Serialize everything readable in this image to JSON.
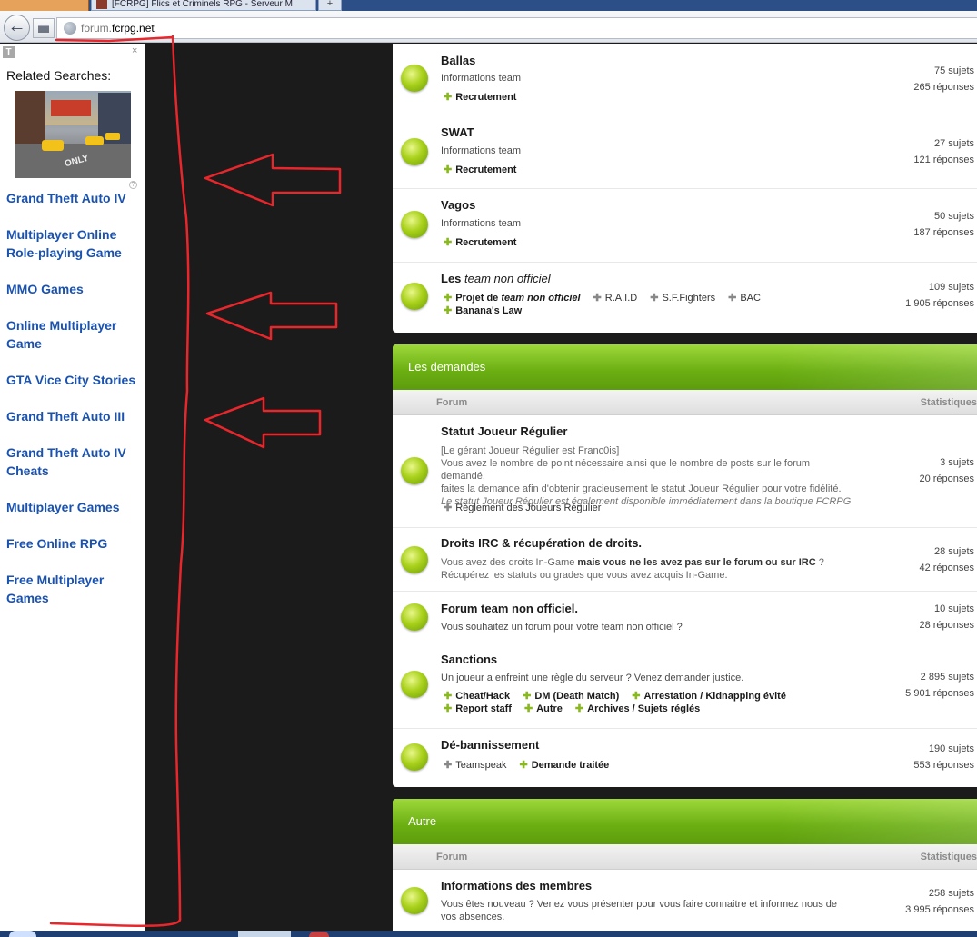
{
  "browser": {
    "tab_title": "[FCRPG] Flics et Criminels RPG - Serveur M",
    "new_tab": "+",
    "back_glyph": "←",
    "url_prefix": "forum.",
    "url_host": "fcrpg.net"
  },
  "sidepanel": {
    "badge": "T",
    "close": "×",
    "help": "?",
    "title": "Related Searches:",
    "image_caption": "ONLY",
    "links": [
      "Grand Theft Auto IV",
      "Multiplayer Online Role-playing Game",
      "MMO Games",
      "Online Multiplayer Game",
      "GTA Vice City Stories",
      "Grand Theft Auto III",
      "Grand Theft Auto IV Cheats",
      "Multiplayer Games",
      "Free Online RPG",
      "Free Multiplayer Games"
    ]
  },
  "forum": {
    "top_rows": [
      {
        "title": "Ballas",
        "desc": "Informations team",
        "sub": "Recrutement",
        "topics": "75 sujets",
        "replies": "265 réponses"
      },
      {
        "title": "SWAT",
        "desc": "Informations team",
        "sub": "Recrutement",
        "topics": "27 sujets",
        "replies": "121 réponses"
      },
      {
        "title": "Vagos",
        "desc": "Informations team",
        "sub": "Recrutement",
        "topics": "50 sujets",
        "replies": "187 réponses"
      }
    ],
    "team_row": {
      "title_a": "Les ",
      "title_b": "team non officiel",
      "sub_a1": "Projet de ",
      "sub_a2": "team non officiel",
      "sub_b": "R.A.I.D",
      "sub_c": "S.F.Fighters",
      "sub_d": "BAC",
      "sub_e": "Banana's Law",
      "topics": "109 sujets",
      "replies": "1 905 réponses"
    },
    "cat_demandes": {
      "title": "Les demandes",
      "col_forum": "Forum",
      "col_stats": "Statistiques",
      "statut": {
        "title": "Statut Joueur Régulier",
        "line1": "[Le gérant Joueur Régulier est Franc0is]",
        "line2": "Vous avez le nombre de point nécessaire ainsi que le nombre de posts sur le forum demandé,",
        "line3": "faites la demande afin d'obtenir gracieusement le statut Joueur Régulier pour votre fidélité.",
        "line4": "Le statut Joueur Régulier est également disponible immédiatement dans la boutique FCRPG",
        "sub": "Règlement des Joueurs Régulier",
        "topics": "3 sujets",
        "replies": "20 réponses"
      },
      "irc": {
        "title": "Droits IRC & récupération de droits.",
        "desc_a": "Vous avez des droits In-Game ",
        "desc_b": "mais vous ne les avez pas sur le forum ou sur IRC",
        "desc_c": " ?",
        "desc_d": "Récupérez les statuts ou grades que vous avez acquis In-Game.",
        "topics": "28 sujets",
        "replies": "42 réponses"
      },
      "forum_team": {
        "title": "Forum team non officiel.",
        "desc": "Vous souhaitez un forum pour votre team non officiel ?",
        "topics": "10 sujets",
        "replies": "28 réponses"
      },
      "sanctions": {
        "title": "Sanctions",
        "desc": "Un joueur a enfreint une règle du serveur ? Venez demander justice.",
        "subs": [
          "Cheat/Hack",
          "DM (Death Match)",
          "Arrestation / Kidnapping évité",
          "Report staff",
          "Autre",
          "Archives / Sujets réglés"
        ],
        "topics": "2 895 sujets",
        "replies": "5 901 réponses"
      },
      "deban": {
        "title": "Dé-bannissement",
        "sub_a": "Teamspeak",
        "sub_b": "Demande traitée",
        "topics": "190 sujets",
        "replies": "553 réponses"
      }
    },
    "cat_autre": {
      "title": "Autre",
      "col_forum": "Forum",
      "col_stats": "Statistiques",
      "membres": {
        "title": "Informations des membres",
        "desc1": "Vous êtes nouveau ? Venez vous présenter pour vous faire connaitre et informez nous de",
        "desc2": "vos absences.",
        "topics": "258 sujets",
        "replies": "3 995 réponses"
      }
    }
  },
  "colors": {
    "accent_green": "#6aae12",
    "link_blue": "#1a52b0",
    "annotation_red": "#e8262b"
  }
}
